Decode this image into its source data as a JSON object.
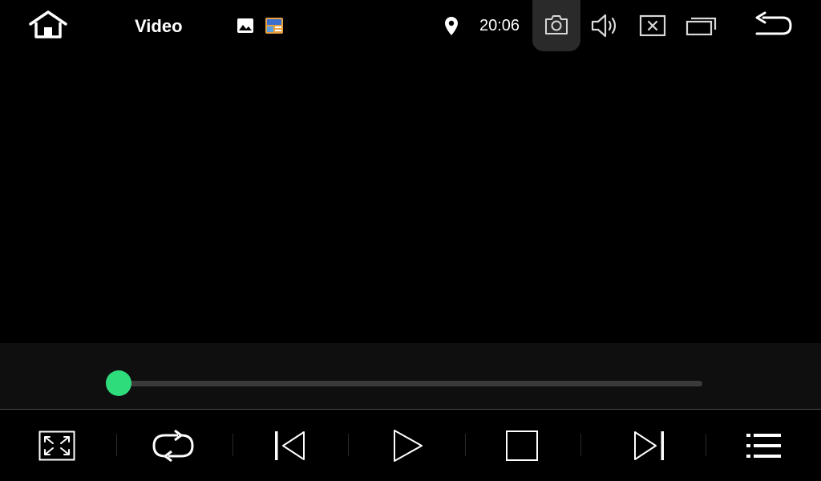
{
  "status_bar": {
    "title": "Video",
    "time": "20:06",
    "icons": {
      "home": "home-icon",
      "notification_image": "image-icon",
      "notification_app": "app-notification-icon",
      "location": "location-pin-icon",
      "screenshot": "camera-icon",
      "volume": "volume-icon",
      "close_app": "close-box-icon",
      "recents": "recent-apps-icon",
      "back": "back-arrow-icon"
    }
  },
  "seek": {
    "progress": 0.0,
    "thumb_color": "#2fdc7c",
    "track_color": "#3a3a3a"
  },
  "controls": [
    {
      "name": "fullscreen",
      "icon": "fullscreen-icon"
    },
    {
      "name": "repeat",
      "icon": "repeat-icon"
    },
    {
      "name": "previous",
      "icon": "skip-previous-icon"
    },
    {
      "name": "play",
      "icon": "play-icon"
    },
    {
      "name": "stop",
      "icon": "stop-icon"
    },
    {
      "name": "next",
      "icon": "skip-next-icon"
    },
    {
      "name": "playlist",
      "icon": "playlist-icon"
    }
  ],
  "colors": {
    "background": "#000000",
    "icon": "#ffffff",
    "accent": "#2fdc7c"
  }
}
